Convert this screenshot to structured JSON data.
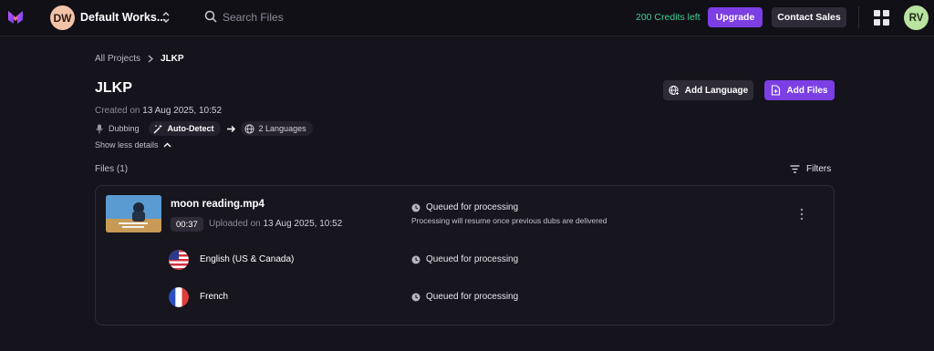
{
  "topbar": {
    "workspace_initials": "DW",
    "workspace_name": "Default Works...",
    "search_placeholder": "Search Files",
    "credits": "200 Credits left",
    "upgrade_label": "Upgrade",
    "contact_label": "Contact Sales",
    "user_initials": "RV",
    "colors": {
      "accent": "#7b3fe4",
      "credits": "#3ecf8e"
    }
  },
  "breadcrumb": {
    "root": "All Projects",
    "current": "JLKP"
  },
  "project": {
    "title": "JLKP",
    "created_prefix": "Created on",
    "created_date": "13 Aug 2025, 10:52",
    "type": "Dubbing",
    "source_language": "Auto-Detect",
    "target_languages": "2 Languages",
    "toggle_details": "Show less details"
  },
  "actions": {
    "add_language": "Add Language",
    "add_files": "Add Files"
  },
  "files": {
    "count_label": "Files (1)",
    "filters_label": "Filters",
    "items": [
      {
        "name": "moon reading.mp4",
        "duration": "00:37",
        "uploaded_prefix": "Uploaded on",
        "uploaded_date": "13 Aug 2025, 10:52",
        "status": "Queued for processing",
        "status_note": "Processing will resume once previous dubs are delivered",
        "languages": [
          {
            "name": "English (US & Canada)",
            "flag": "us-flag-icon",
            "status": "Queued for processing"
          },
          {
            "name": "French",
            "flag": "france-flag-icon",
            "status": "Queued for processing"
          }
        ]
      }
    ]
  }
}
